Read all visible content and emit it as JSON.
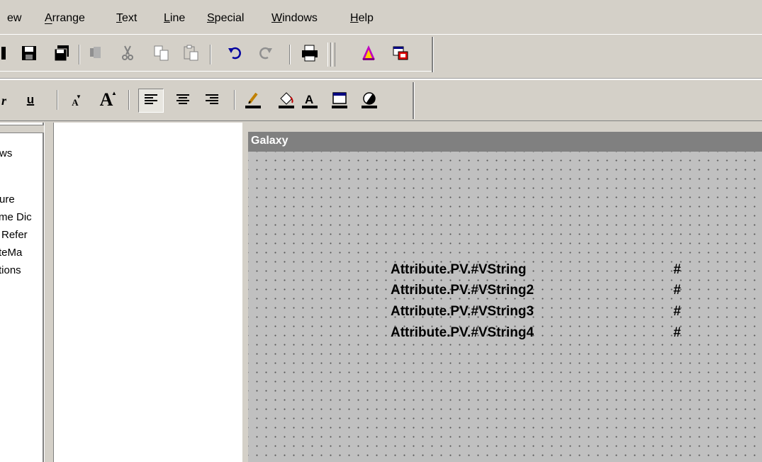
{
  "menu": [
    {
      "label": "ew"
    },
    {
      "label": "Arrange"
    },
    {
      "label": "Text"
    },
    {
      "label": "Line"
    },
    {
      "label": "Special"
    },
    {
      "label": "Windows"
    },
    {
      "label": "Help"
    }
  ],
  "toolbar1": {
    "icons": [
      "partial-icon",
      "save-icon",
      "save-all-icon",
      "cut-icon",
      "cut-icon",
      "copy-icon",
      "paste-icon",
      "undo-icon",
      "redo-icon",
      "print-icon",
      "wizard-icon",
      "app-icon"
    ]
  },
  "toolbar2": {
    "underline_label": "u",
    "font_small_label": "A",
    "font_large_label": "A"
  },
  "tree": {
    "items": [
      "ws",
      "ure",
      "me Dic",
      "Refer",
      "teMa",
      "tions"
    ]
  },
  "galaxy": {
    "title": "Galaxy",
    "rows": [
      {
        "ref": "Attribute.PV.#VString",
        "value": "#"
      },
      {
        "ref": "Attribute.PV.#VString2",
        "value": "#"
      },
      {
        "ref": "Attribute.PV.#VString3",
        "value": "#"
      },
      {
        "ref": "Attribute.PV.#VString4",
        "value": "#"
      }
    ]
  },
  "colors": {
    "chrome": "#d4d0c8",
    "title_bar": "#808080",
    "canvas": "#c0c0c0"
  }
}
